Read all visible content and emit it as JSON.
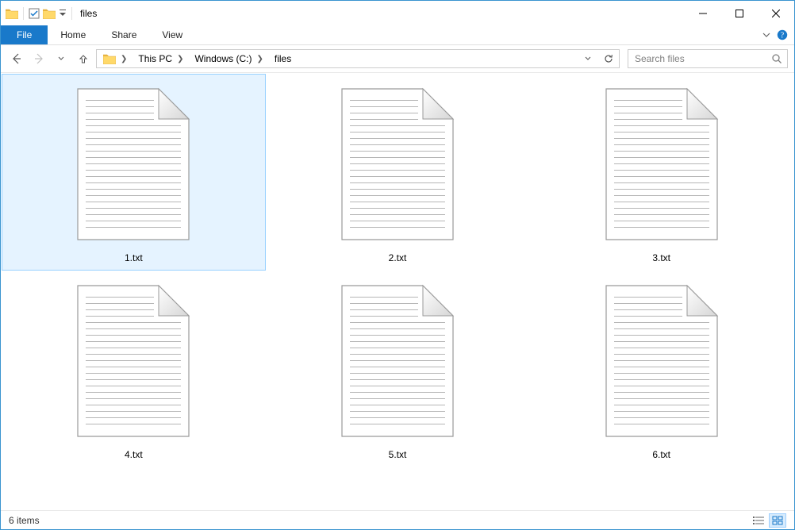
{
  "title": "files",
  "ribbon": {
    "file": "File",
    "tabs": [
      "Home",
      "Share",
      "View"
    ]
  },
  "breadcrumb": [
    "This PC",
    "Windows (C:)",
    "files"
  ],
  "search": {
    "placeholder": "Search files"
  },
  "files": [
    {
      "name": "1.txt",
      "selected": true
    },
    {
      "name": "2.txt",
      "selected": false
    },
    {
      "name": "3.txt",
      "selected": false
    },
    {
      "name": "4.txt",
      "selected": false
    },
    {
      "name": "5.txt",
      "selected": false
    },
    {
      "name": "6.txt",
      "selected": false
    }
  ],
  "status": {
    "count_label": "6 items"
  }
}
